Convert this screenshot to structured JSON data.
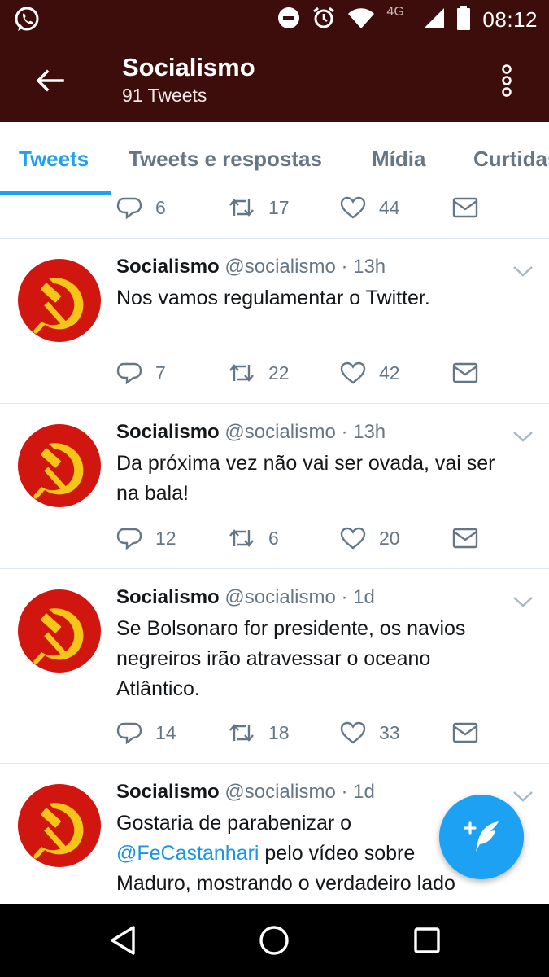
{
  "status_bar": {
    "time": "08:12",
    "network": "4G",
    "icons": [
      "whatsapp-icon",
      "do-not-disturb-icon",
      "alarm-icon",
      "wifi-icon",
      "signal-icon",
      "battery-icon"
    ]
  },
  "header": {
    "title": "Socialismo",
    "subtitle": "91 Tweets",
    "background": "#3d0d0b"
  },
  "tabs": [
    {
      "label": "Tweets",
      "active": true
    },
    {
      "label": "Tweets e respostas",
      "active": false
    },
    {
      "label": "Mídia",
      "active": false
    },
    {
      "label": "Curtidas",
      "active": false
    }
  ],
  "partial_tweet": {
    "replies": "6",
    "retweets": "17",
    "likes": "44"
  },
  "tweets": [
    {
      "name": "Socialismo",
      "meta": "@socialismo · 13h",
      "text": "Nos vamos regulamentar o Twitter.",
      "replies": "7",
      "retweets": "22",
      "likes": "42"
    },
    {
      "name": "Socialismo",
      "meta": "@socialismo · 13h",
      "text": "Da próxima vez não vai ser ovada, vai ser\nna bala!",
      "replies": "12",
      "retweets": "6",
      "likes": "20"
    },
    {
      "name": "Socialismo",
      "meta": "@socialismo · 1d",
      "text": "Se Bolsonaro for presidente, os navios\nnegreiros irão atravessar o oceano\nAtlântico.",
      "replies": "14",
      "retweets": "18",
      "likes": "33"
    },
    {
      "name": "Socialismo",
      "meta": "@socialismo · 1d",
      "text_start": "Gostaria de parabenizar o\n",
      "mention": "@FeCastanhari",
      "text_end": " pelo vídeo sobre\nMaduro, mostrando o verdadeiro lado\ndo socialismo"
    }
  ],
  "fab": {
    "icon": "compose-tweet-icon"
  },
  "colors": {
    "accent": "#1da1f2",
    "mention": "#1b95e0",
    "secondary_text": "#657786",
    "avatar_red": "#d1160f",
    "hammer_sickle": "#f5c518"
  }
}
